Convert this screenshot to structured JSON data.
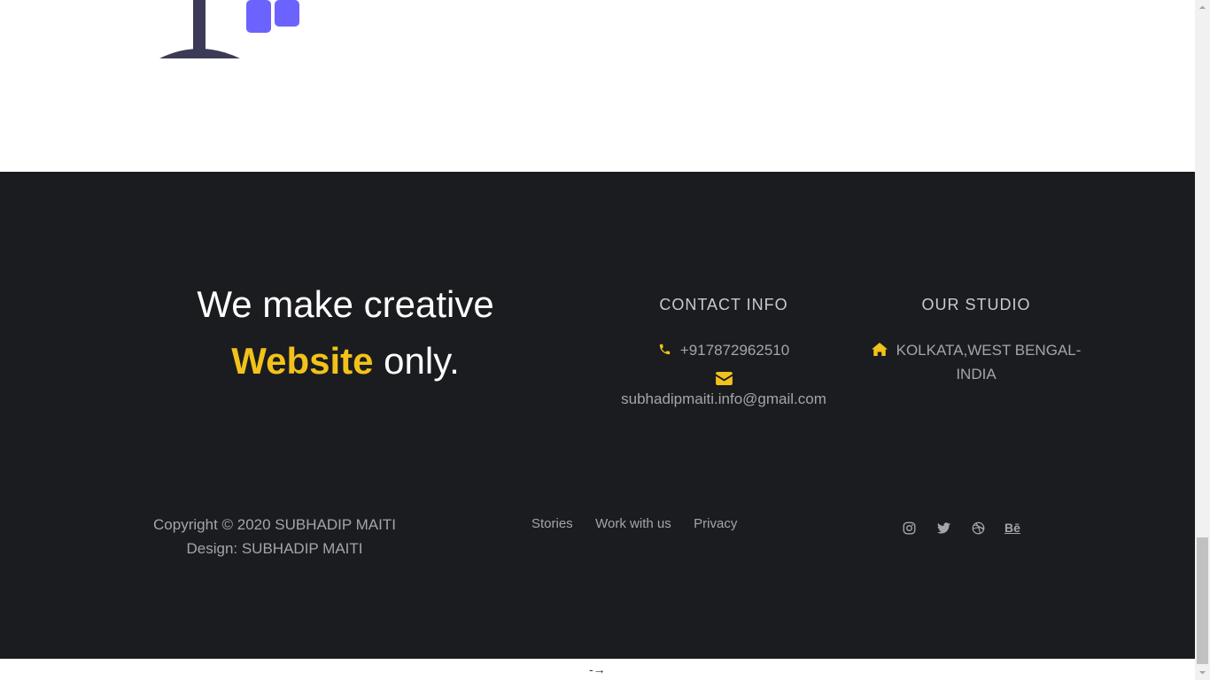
{
  "footer": {
    "tagline": {
      "line1": "We make creative",
      "accent": "Website",
      "rest": " only."
    },
    "contact": {
      "title": "CONTACT INFO",
      "phone": "+917872962510",
      "email": "subhadipmaiti.info@gmail.com"
    },
    "studio": {
      "title": "OUR STUDIO",
      "address_line1": "KOLKATA,WEST BENGAL-",
      "address_line2": "INDIA"
    },
    "copyright": {
      "line1": "Copyright © 2020 SUBHADIP MAITI",
      "line2": "Design: SUBHADIP MAITI"
    },
    "links": [
      {
        "label": "Stories"
      },
      {
        "label": "Work with us"
      },
      {
        "label": "Privacy"
      }
    ],
    "social": [
      {
        "icon": "instagram-icon"
      },
      {
        "icon": "twitter-icon"
      },
      {
        "icon": "dribbble-icon"
      },
      {
        "icon": "behance-icon",
        "label": "Bē"
      }
    ]
  },
  "bottom": {
    "arrow_hint": "-→"
  },
  "colors": {
    "footer_bg": "#1b1c1f",
    "accent": "#f2c21b",
    "text_muted": "#a4a5a9",
    "illustration_dark": "#3b3b57",
    "illustration_purple": "#6c63ff"
  }
}
